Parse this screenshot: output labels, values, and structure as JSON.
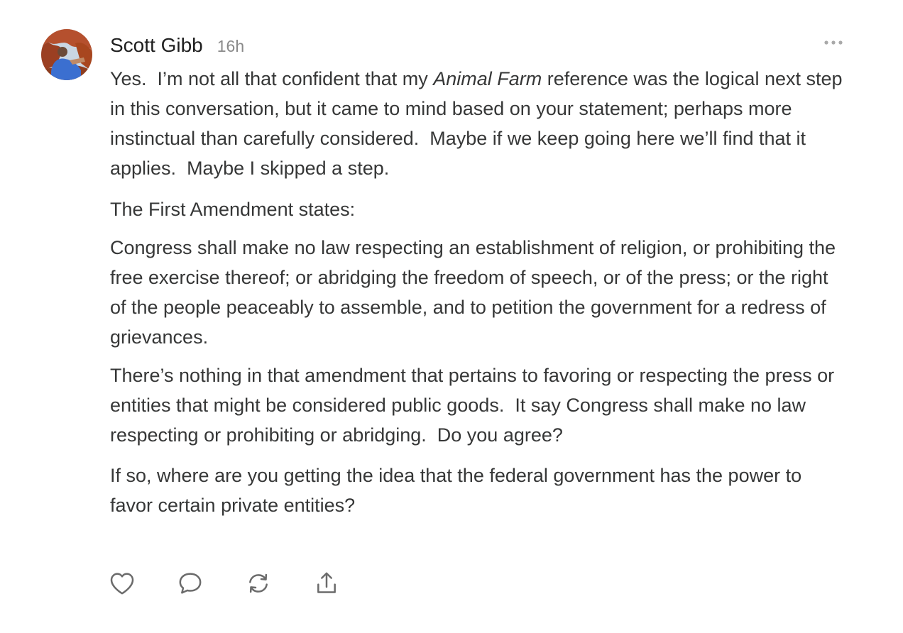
{
  "comment": {
    "author": "Scott Gibb",
    "timestamp": "16h",
    "avatar_icon": "avatar-photo",
    "more_icon": "ellipsis-icon",
    "paragraphs": {
      "p1_before": "Yes.  I’m not all that confident that my ",
      "p1_italic": "Animal Farm",
      "p1_after": " reference was the logical next step in this conversation, but it came to mind based on your statement; perhaps more instinctual than carefully considered.  Maybe if we keep going here we’ll find that it applies.  Maybe I skipped a step.",
      "p2": "The First Amendment states:",
      "p3": "Congress shall make no law respecting an establishment of religion, or prohibiting the free exercise thereof; or abridging the freedom of speech, or of the press; or the right of the people peaceably to assemble, and to petition the government for a redress of grievances.",
      "p4": "There’s nothing in that amendment that pertains to favoring or respecting the press or entities that might be considered public goods.  It say Congress shall make no law respecting or prohibiting or abridging.  Do you agree?",
      "p5": "If so, where are you getting the idea that the federal government has the power to favor certain private entities?"
    },
    "actions": [
      {
        "name": "like",
        "icon": "heart-icon"
      },
      {
        "name": "reply",
        "icon": "chat-bubble-icon"
      },
      {
        "name": "restack",
        "icon": "refresh-icon"
      },
      {
        "name": "share",
        "icon": "share-icon"
      }
    ]
  },
  "colors": {
    "text": "#363737",
    "author": "#1f1f1f",
    "muted": "#8a8a8a",
    "icon": "#6b6b6b"
  }
}
